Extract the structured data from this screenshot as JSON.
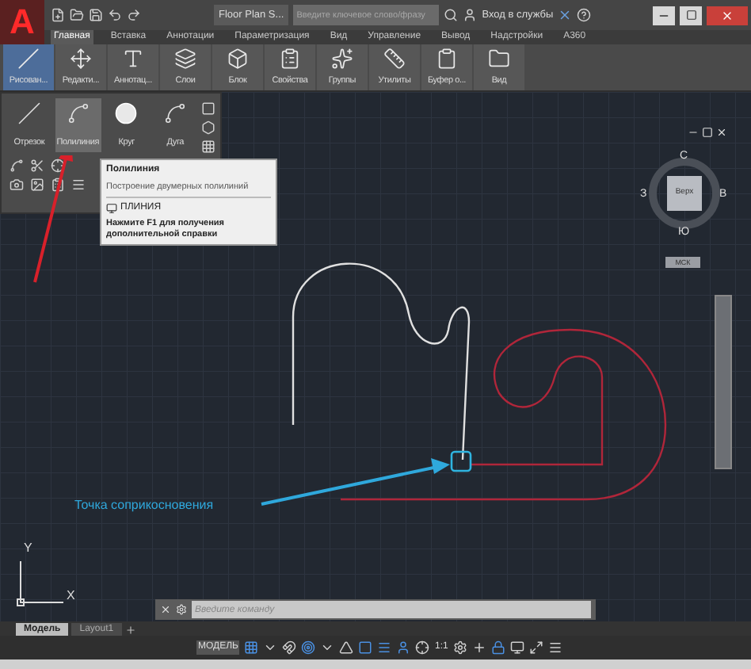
{
  "logo": "A",
  "title_bar": {
    "title": "Floor Plan S...",
    "search": {
      "placeholder": "Введите ключевое слово/фразу"
    },
    "sign_in": "Вход в службы"
  },
  "ribbon_tabs": [
    {
      "label": "Главная",
      "selected": true
    },
    {
      "label": "Вставка",
      "selected": false
    },
    {
      "label": "Аннотации",
      "selected": false
    },
    {
      "label": "Параметризация",
      "selected": false
    },
    {
      "label": "Вид",
      "selected": false
    },
    {
      "label": "Управление",
      "selected": false
    },
    {
      "label": "Вывод",
      "selected": false
    },
    {
      "label": "Надстройки",
      "selected": false
    },
    {
      "label": "A360",
      "selected": false
    }
  ],
  "ribbon_panels": [
    {
      "label": "Рисован...",
      "selected": true
    },
    {
      "label": "Редакти...",
      "selected": false
    },
    {
      "label": "Аннотац...",
      "selected": false
    },
    {
      "label": "Слои",
      "selected": false
    },
    {
      "label": "Блок",
      "selected": false
    },
    {
      "label": "Свойства",
      "selected": false
    },
    {
      "label": "Группы",
      "selected": false
    },
    {
      "label": "Утилиты",
      "selected": false
    },
    {
      "label": "Буфер о...",
      "selected": false
    },
    {
      "label": "Вид",
      "selected": false
    }
  ],
  "draw_panel": {
    "tools": [
      {
        "label": "Отрезок",
        "selected": false
      },
      {
        "label": "Полилиния",
        "selected": true
      },
      {
        "label": "Круг",
        "selected": false
      },
      {
        "label": "Дуга",
        "selected": false
      }
    ]
  },
  "tooltip": {
    "title": "Полилиния",
    "description": "Построение двумерных полилиний",
    "command": "ПЛИНИЯ",
    "help": "Нажмите F1 для получения дополнительной справки"
  },
  "viewcube": {
    "north": "С",
    "west": "З",
    "east": "В",
    "south": "Ю",
    "face": "Верх",
    "ucs": "МСК"
  },
  "callout": "Точка соприкосновения",
  "ucs_axes": {
    "y": "Y",
    "x": "X"
  },
  "command_line": {
    "placeholder": "Введите команду"
  },
  "layout_tabs": [
    {
      "label": "Модель",
      "selected": true
    },
    {
      "label": "Layout1",
      "selected": false
    }
  ],
  "status_bar": {
    "mode": "МОДЕЛЬ",
    "scale": "1:1"
  }
}
